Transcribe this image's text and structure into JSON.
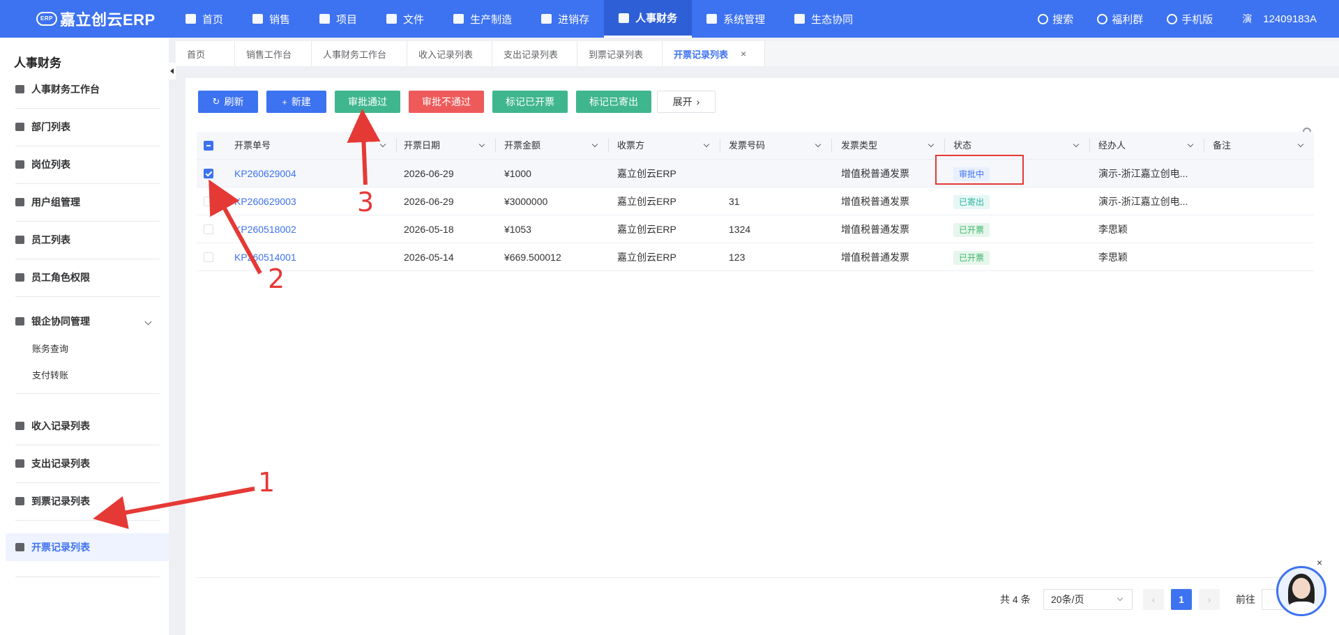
{
  "brand": {
    "name": "嘉立创云ERP",
    "mark": "ERP"
  },
  "nav": {
    "items": [
      {
        "label": "首页",
        "icon": "monitor-icon"
      },
      {
        "label": "销售",
        "icon": "cart-icon"
      },
      {
        "label": "项目",
        "icon": "layers-icon"
      },
      {
        "label": "文件",
        "icon": "folder-icon"
      },
      {
        "label": "生产制造",
        "icon": "gear-icon"
      },
      {
        "label": "进销存",
        "icon": "box-icon"
      },
      {
        "label": "人事财务",
        "icon": "finance-icon",
        "active": true
      },
      {
        "label": "系统管理",
        "icon": "settings-icon"
      },
      {
        "label": "生态协同",
        "icon": "cluster-icon"
      }
    ],
    "search": "搜索",
    "welfare": "福利群",
    "mobile": "手机版",
    "user_initial": "演",
    "user_id": "12409183A"
  },
  "sidebar": {
    "title": "人事财务",
    "items": [
      {
        "label": "人事财务工作台"
      },
      {
        "label": "部门列表"
      },
      {
        "label": "岗位列表"
      },
      {
        "label": "用户组管理"
      },
      {
        "label": "员工列表"
      },
      {
        "label": "员工角色权限"
      },
      {
        "label": "银企协同管理"
      },
      {
        "label": "收入记录列表"
      },
      {
        "label": "支出记录列表"
      },
      {
        "label": "到票记录列表"
      },
      {
        "label": "开票记录列表"
      }
    ],
    "sub_items": [
      "账务查询",
      "支付转账"
    ]
  },
  "tabs": [
    "首页",
    "销售工作台",
    "人事财务工作台",
    "收入记录列表",
    "支出记录列表",
    "到票记录列表",
    "开票记录列表"
  ],
  "toolbar": {
    "refresh": "刷新",
    "new": "新建",
    "approve": "审批通过",
    "reject": "审批不通过",
    "mark_invoiced": "标记已开票",
    "mark_sent": "标记已寄出",
    "expand": "展开"
  },
  "table": {
    "columns": [
      "开票单号",
      "开票日期",
      "开票金额",
      "收票方",
      "发票号码",
      "发票类型",
      "状态",
      "经办人",
      "备注"
    ],
    "rows": [
      {
        "no": "KP260629004",
        "date": "2026-06-29",
        "amount": "¥1000",
        "payee": "嘉立创云ERP",
        "invoice_no": "",
        "type": "增值税普通发票",
        "status": "审批中",
        "handler": "演示-浙江嘉立创电...",
        "note": "",
        "checked": true
      },
      {
        "no": "KP260629003",
        "date": "2026-06-29",
        "amount": "¥3000000",
        "payee": "嘉立创云ERP",
        "invoice_no": "31",
        "type": "增值税普通发票",
        "status": "已寄出",
        "handler": "演示-浙江嘉立创电...",
        "note": "",
        "checked": false
      },
      {
        "no": "KP260518002",
        "date": "2026-05-18",
        "amount": "¥1053",
        "payee": "嘉立创云ERP",
        "invoice_no": "1324",
        "type": "增值税普通发票",
        "status": "已开票",
        "handler": "李思颖",
        "note": "",
        "checked": false
      },
      {
        "no": "KP260514001",
        "date": "2026-05-14",
        "amount": "¥669.500012",
        "payee": "嘉立创云ERP",
        "invoice_no": "123",
        "type": "增值税普通发票",
        "status": "已开票",
        "handler": "李思颖",
        "note": "",
        "checked": false
      }
    ]
  },
  "pagination": {
    "total": "共 4 条",
    "page_size": "20条/页",
    "current_page": "1",
    "goto": "前往"
  },
  "annotations": [
    "1",
    "2",
    "3"
  ],
  "colors": {
    "primary": "#3d72f0",
    "approve": "#3fb68e",
    "reject": "#ee5a5a",
    "highlight": "#e53935"
  }
}
